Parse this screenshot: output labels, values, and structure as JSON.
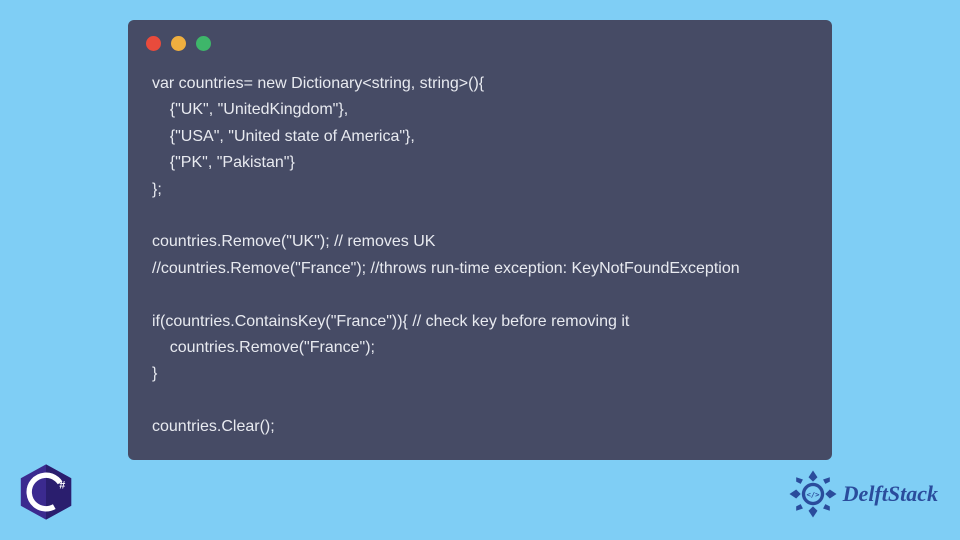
{
  "window": {
    "controls": [
      "red",
      "yellow",
      "green"
    ]
  },
  "code": {
    "line1": "var countries= new Dictionary<string, string>(){",
    "line2": "    {\"UK\", \"UnitedKingdom\"},",
    "line3": "    {\"USA\", \"United state of America\"},",
    "line4": "    {\"PK\", \"Pakistan\"}",
    "line5": "};",
    "line6": "",
    "line7": "countries.Remove(\"UK\"); // removes UK",
    "line8": "//countries.Remove(\"France\"); //throws run-time exception: KeyNotFoundException",
    "line9": "",
    "line10": "if(countries.ContainsKey(\"France\")){ // check key before removing it",
    "line11": "    countries.Remove(\"France\");",
    "line12": "}",
    "line13": "",
    "line14": "countries.Clear();"
  },
  "csharp": {
    "label": "C#"
  },
  "brand": {
    "name": "DelftStack"
  }
}
